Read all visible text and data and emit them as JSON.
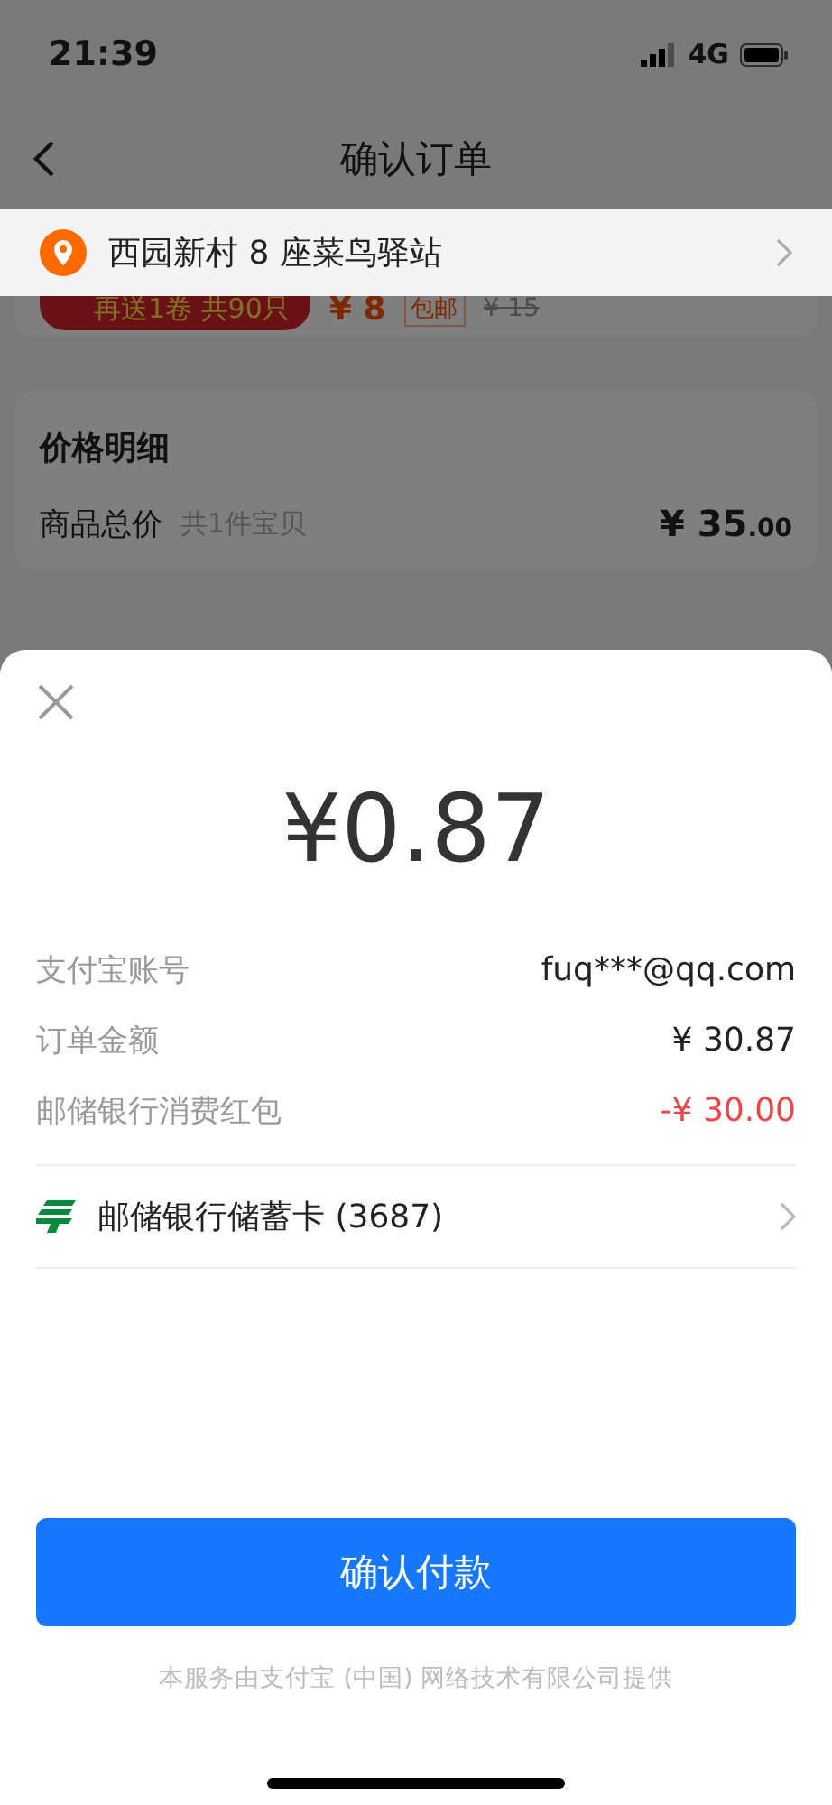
{
  "status_bar": {
    "time": "21:39",
    "network": "4G"
  },
  "nav": {
    "title": "确认订单"
  },
  "address": {
    "text": "西园新村 8 座菜鸟驿站"
  },
  "product": {
    "promo": "再送1卷 共90只",
    "price": "¥ 8",
    "tag": "包邮",
    "original_price": "¥ 15"
  },
  "price_detail": {
    "title": "价格明细",
    "rows": [
      {
        "label": "商品总价",
        "note": "共1件宝贝",
        "value": "¥ 35",
        "decimals": ".00"
      }
    ]
  },
  "payment": {
    "amount": "¥0.87",
    "rows": [
      {
        "label": "支付宝账号",
        "value": "fuq***@qq.com",
        "kind": "plain"
      },
      {
        "label": "订单金额",
        "value": "¥ 30.87",
        "kind": "plain"
      },
      {
        "label": "邮储银行消费红包",
        "value": "-¥ 30.00",
        "kind": "discount"
      }
    ],
    "method": {
      "name": "邮储银行储蓄卡 (3687)"
    },
    "confirm": "确认付款",
    "footer": "本服务由支付宝 (中国) 网络技术有限公司提供"
  }
}
